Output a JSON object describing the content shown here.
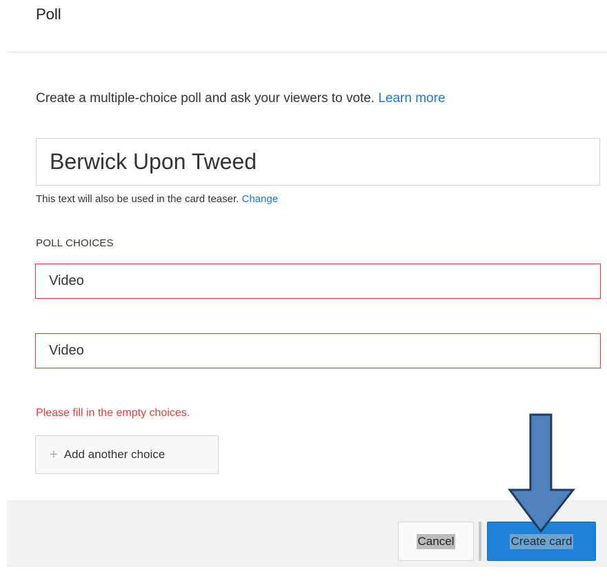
{
  "dialog": {
    "title": "Poll"
  },
  "intro": {
    "description": "Create a multiple-choice poll and ask your viewers to vote.",
    "learn_more_label": "Learn more"
  },
  "question": {
    "value": "Berwick Upon Tweed",
    "helper_text": "This text will also be used in the card teaser.",
    "change_label": "Change"
  },
  "poll_choices": {
    "label": "POLL CHOICES",
    "items": [
      {
        "value": "Video"
      },
      {
        "value": "Video"
      }
    ],
    "error": "Please fill in the empty choices.",
    "add_label": "Add another choice"
  },
  "footer": {
    "cancel_label": "Cancel",
    "create_label": "Create card"
  },
  "colors": {
    "link": "#167ac6",
    "error": "#e53b36",
    "primary_button": "#1f82d8",
    "annotation_arrow": "#4f81bd"
  },
  "icons": {
    "add": "plus-icon",
    "annotation": "down-arrow-annotation"
  }
}
